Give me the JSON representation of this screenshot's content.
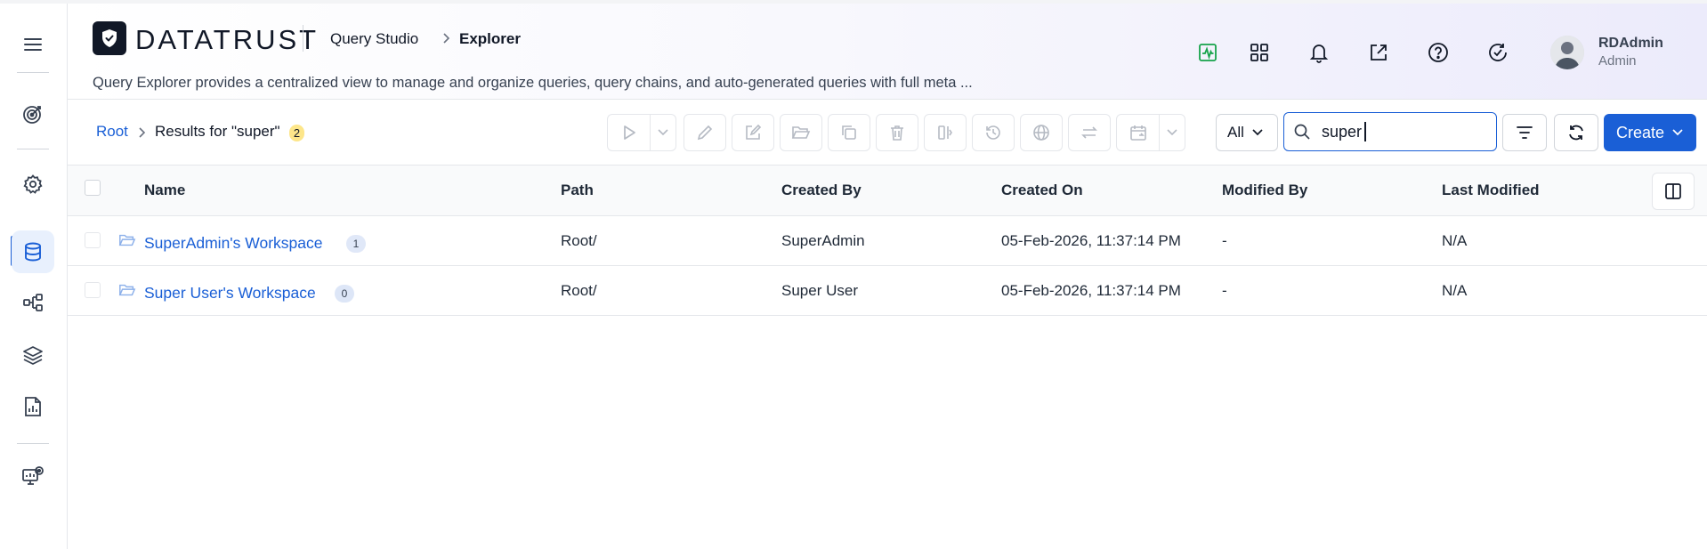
{
  "header": {
    "logo_text": "DATATRUST",
    "breadcrumb": [
      "Query Studio",
      "Explorer"
    ],
    "description": "Query Explorer provides a centralized view to manage and organize queries, query chains, and auto-generated queries with full meta ...",
    "user": {
      "name": "RDAdmin",
      "role": "Admin"
    }
  },
  "toolbar": {
    "root_label": "Root",
    "results_label": "Results for \"super\"",
    "results_count": "2",
    "filter_value": "All",
    "search_value": "super",
    "create_label": "Create"
  },
  "table": {
    "columns": [
      "Name",
      "Path",
      "Created By",
      "Created On",
      "Modified By",
      "Last Modified"
    ],
    "rows": [
      {
        "name": "SuperAdmin's Workspace",
        "count": "1",
        "path": "Root/",
        "created_by": "SuperAdmin",
        "created_on": "05-Feb-2026, 11:37:14 PM",
        "modified_by": "-",
        "last_modified": "N/A"
      },
      {
        "name": "Super User's Workspace",
        "count": "0",
        "path": "Root/",
        "created_by": "Super User",
        "created_on": "05-Feb-2026, 11:37:14 PM",
        "modified_by": "-",
        "last_modified": "N/A"
      }
    ]
  },
  "colors": {
    "accent": "#1a5fd6",
    "count_badge": "#fde68a",
    "activity_icon": "#16a34a"
  },
  "icons": {
    "rail": [
      "menu-icon",
      "target-icon",
      "gear-icon",
      "database-icon",
      "hierarchy-icon",
      "layers-icon",
      "report-icon",
      "monitor-icon"
    ],
    "header": [
      "activity-icon",
      "apps-grid-icon",
      "bell-icon",
      "external-link-icon",
      "help-icon",
      "refresh-check-icon"
    ],
    "toolbar": [
      "play-icon",
      "pencil-icon",
      "edit-icon",
      "folder-open-icon",
      "copy-icon",
      "trash-icon",
      "split-icon",
      "history-icon",
      "globe-icon",
      "transfer-icon",
      "calendar-icon",
      "search-icon",
      "filter-icon",
      "refresh-icon"
    ]
  }
}
